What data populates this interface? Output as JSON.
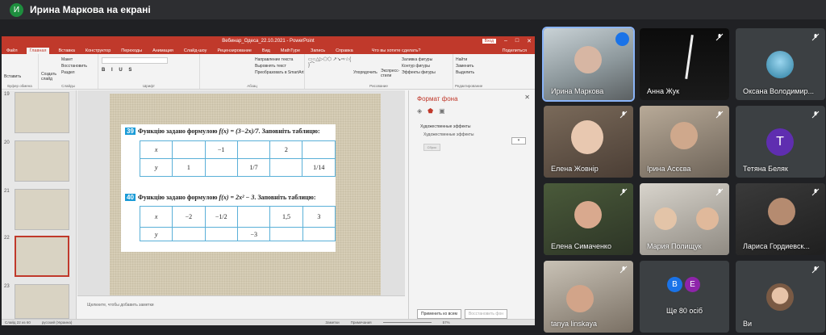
{
  "meeting": {
    "presenter_initial": "И",
    "presenter_banner": "Ирина Маркова на екрані"
  },
  "ppt": {
    "window_title": "Вебинар_Одеса_22.10.2021 - PowerPoint",
    "sign_in": "Вход",
    "tabs": [
      "Файл",
      "Главная",
      "Вставка",
      "Конструктор",
      "Переходы",
      "Анимация",
      "Слайд-шоу",
      "Рецензирование",
      "Вид",
      "MathType",
      "Запись",
      "Справка"
    ],
    "tell_me": "Что вы хотите сделать?",
    "share": "Поделиться",
    "ribbon": {
      "clipboard": {
        "paste": "Вставить",
        "cut": "Макет",
        "copy": "Восстановить",
        "format": "Раздел",
        "label": "Буфер обмена"
      },
      "slides": {
        "new": "Создать слайд",
        "label": "Слайды"
      },
      "font": {
        "label": "Шрифт"
      },
      "paragraph": {
        "dir": "Направление текста",
        "align": "Выровнять текст",
        "smart": "Преобразовать в SmartArt",
        "label": "Абзац"
      },
      "drawing": {
        "arrange": "Упорядочить",
        "styles": "Экспресс-стили",
        "fill": "Заливка фигуры",
        "outline": "Контур фигуры",
        "effects": "Эффекты фигуры",
        "label": "Рисование"
      },
      "editing": {
        "find": "Найти",
        "replace": "Заменить",
        "select": "Выделить",
        "label": "Редактирование"
      }
    },
    "thumbs": [
      {
        "num": "19"
      },
      {
        "num": "20"
      },
      {
        "num": "21"
      },
      {
        "num": "22"
      },
      {
        "num": "23"
      }
    ],
    "slide": {
      "q1_num": "39",
      "q1_text": "Функцію задано формулою",
      "q1_formula": "f(x) = (3−2x)/7",
      "q1_tail": ". Заповніть таблицю:",
      "t1_r1": [
        "x",
        "",
        "−1",
        "",
        "2",
        ""
      ],
      "t1_r2": [
        "y",
        "1",
        "",
        "1/7",
        "",
        "1/14"
      ],
      "q2_num": "40",
      "q2_text": "Функцію задано формулою",
      "q2_formula": "f(x) = 2x² − 3",
      "q2_tail": ". Заповніть таблицю:",
      "t2_r1": [
        "x",
        "−2",
        "−1/2",
        "",
        "1,5",
        "3"
      ],
      "t2_r2": [
        "y",
        "",
        "",
        "−3",
        "",
        ""
      ]
    },
    "notes": "Щелкните, чтобы добавить заметки",
    "pane": {
      "title": "Формат фона",
      "section": "Художественные эффекты",
      "sub": "Художественные эффекты",
      "reset": "Сброс",
      "apply_all": "Применить ко всем",
      "restore": "Восстановить фон"
    },
    "status": {
      "slide": "Слайд 22 из 60",
      "lang": "русский (Украина)",
      "notes_btn": "Заметки",
      "comments": "Примечания",
      "zoom": "57%"
    }
  },
  "participants": [
    {
      "name": "Ирина Маркова"
    },
    {
      "name": "Анна Жук"
    },
    {
      "name": "Оксана Володимир..."
    },
    {
      "name": "Елена Жовнір"
    },
    {
      "name": "Ірина Асєєва"
    },
    {
      "name": "Тетяна Беляк",
      "initial": "T"
    },
    {
      "name": "Елена Симаченко"
    },
    {
      "name": "Мария Полищук"
    },
    {
      "name": "Лариса Гордиевск..."
    },
    {
      "name": "tanya linskaya"
    },
    {
      "name": "Ще 80 осіб",
      "initials": [
        "B",
        "E"
      ]
    },
    {
      "name": "Ви"
    }
  ],
  "colors": {
    "accent": "#c0392b",
    "meet_bg": "#202124",
    "tile_bg": "#3c4043",
    "table_line": "#5ab0d8"
  }
}
